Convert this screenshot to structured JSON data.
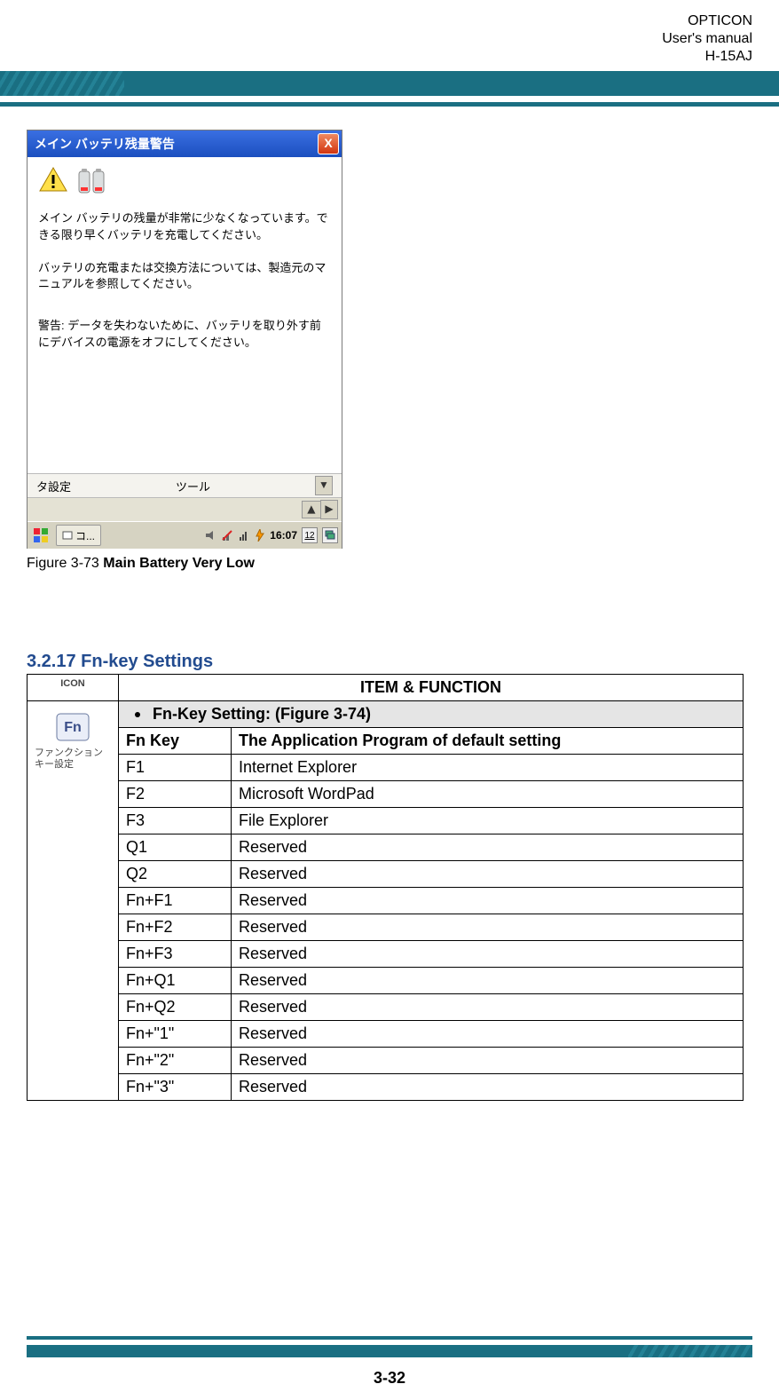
{
  "header": {
    "brand": "OPTICON",
    "doc": "User's manual",
    "model": "H-15AJ"
  },
  "screenshot": {
    "title": "メイン バッテリ残量警告",
    "close_glyph": "X",
    "msg1": "メイン バッテリの残量が非常に少なくなっています。できる限り早くバッテリを充電してください。",
    "msg2": "バッテリの充電または交換方法については、製造元のマニュアルを参照してください。",
    "msg3": "警告: データを失わないために、バッテリを取り外す前にデバイスの電源をオフにしてください。",
    "tab_left": "タ設定",
    "tab_right": "ツール",
    "task_label": "コ...",
    "clock": "16:07",
    "tray_num": "12"
  },
  "figure": {
    "prefix": "Figure 3-73 ",
    "title": "Main Battery Very Low"
  },
  "section": {
    "heading": "3.2.17 Fn-key Settings"
  },
  "table": {
    "head_icon": "ICON",
    "head_item": "ITEM & FUNCTION",
    "subhead": "Fn-Key Setting: (Figure 3-74)",
    "icon_caption": "ファンクションキー設定",
    "col_key": "Fn Key",
    "col_app": "The Application Program of default setting",
    "rows": [
      {
        "key": "F1",
        "app": "Internet Explorer"
      },
      {
        "key": "F2",
        "app": "Microsoft WordPad"
      },
      {
        "key": "F3",
        "app": "File Explorer"
      },
      {
        "key": "Q1",
        "app": "Reserved"
      },
      {
        "key": "Q2",
        "app": "Reserved"
      },
      {
        "key": "Fn+F1",
        "app": "Reserved"
      },
      {
        "key": "Fn+F2",
        "app": "Reserved"
      },
      {
        "key": "Fn+F3",
        "app": "Reserved"
      },
      {
        "key": "Fn+Q1",
        "app": "Reserved"
      },
      {
        "key": "Fn+Q2",
        "app": "Reserved"
      },
      {
        "key": "Fn+\"1\"",
        "app": "Reserved"
      },
      {
        "key": "Fn+\"2\"",
        "app": "Reserved"
      },
      {
        "key": "Fn+\"3\"",
        "app": "Reserved"
      }
    ]
  },
  "page_number": "3-32"
}
